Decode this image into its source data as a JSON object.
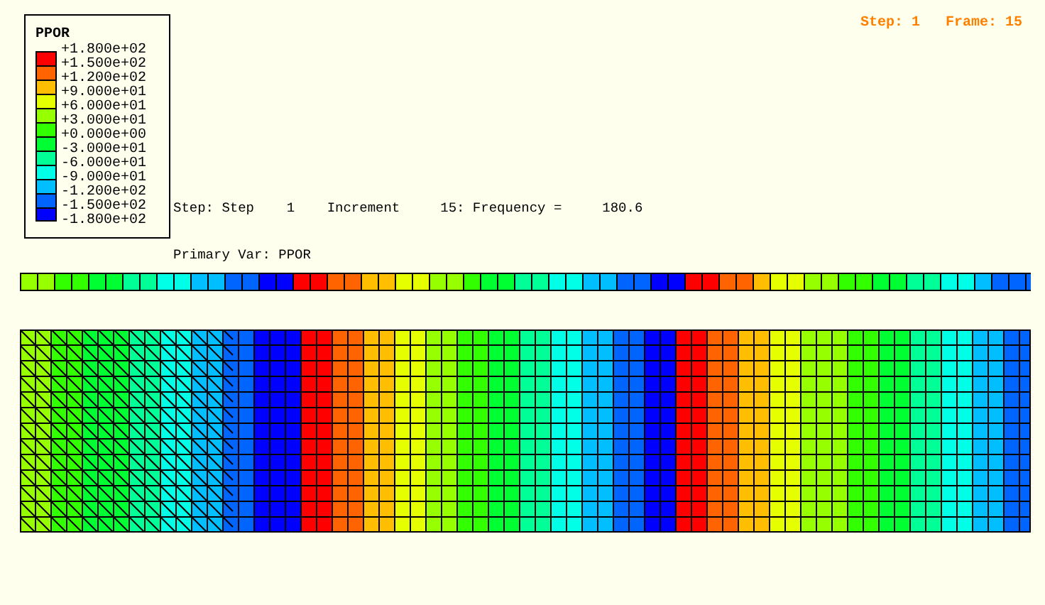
{
  "legend": {
    "title": "PPOR",
    "bands": [
      {
        "color": "#ff0000"
      },
      {
        "color": "#ff6400"
      },
      {
        "color": "#ffbe00"
      },
      {
        "color": "#e6ff00"
      },
      {
        "color": "#96ff00"
      },
      {
        "color": "#32ff00"
      },
      {
        "color": "#00ff32"
      },
      {
        "color": "#00ff96"
      },
      {
        "color": "#00ffe6"
      },
      {
        "color": "#00beff"
      },
      {
        "color": "#0064ff"
      },
      {
        "color": "#0000ff"
      }
    ],
    "labels": [
      "+1.800e+02",
      "+1.500e+02",
      "+1.200e+02",
      "+9.000e+01",
      "+6.000e+01",
      "+3.000e+01",
      "+0.000e+00",
      "-3.000e+01",
      "-6.000e+01",
      "-9.000e+01",
      "-1.200e+02",
      "-1.500e+02",
      "-1.800e+02"
    ]
  },
  "info": {
    "step_line": "Step: Step    1    Increment     15: Frequency =     180.6",
    "primary_var": "Primary Var: PPOR"
  },
  "frame_label": "Step: 1   Frame: 15"
}
